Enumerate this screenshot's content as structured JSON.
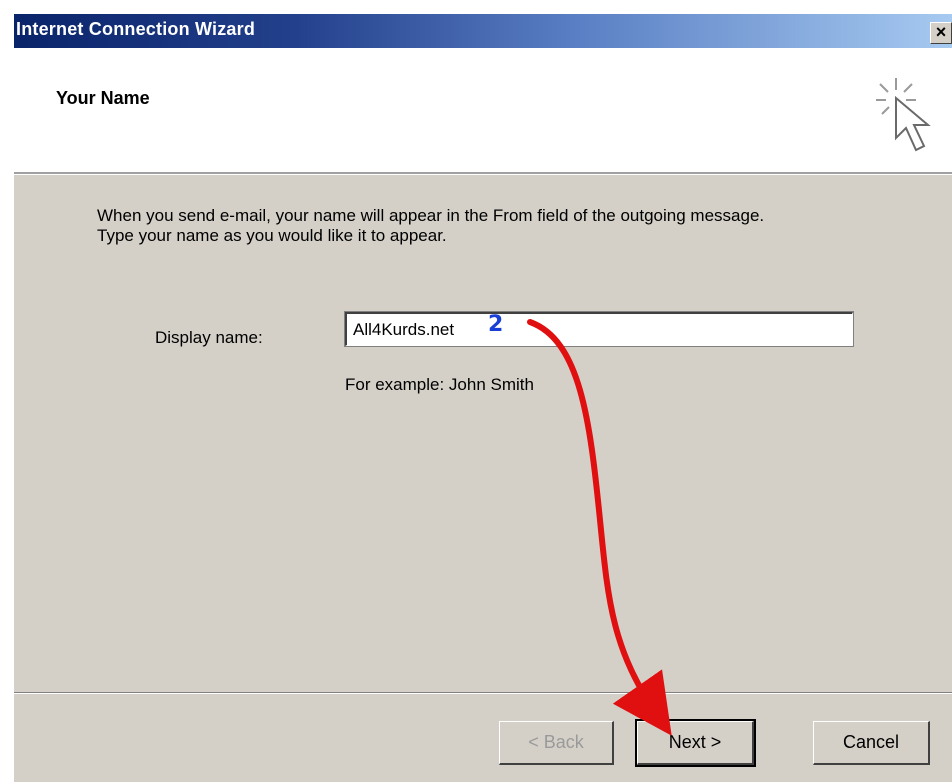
{
  "window": {
    "title": "Internet Connection Wizard",
    "close_glyph": "✕"
  },
  "header": {
    "title": "Your Name",
    "icon": "wizard-cursor-sparkle-icon"
  },
  "body": {
    "description_line1": "When you send e-mail, your name will appear in the From field of the outgoing message.",
    "description_line2": "Type your name as you would like it to appear.",
    "display_name_label": "Display name:",
    "display_name_value": "All4Kurds.net",
    "example_text": "For example: John Smith"
  },
  "annotation": {
    "step_number": "2",
    "arrow_color": "#e01010",
    "number_color": "#1a3fd6"
  },
  "buttons": {
    "back": "< Back",
    "next": "Next >",
    "cancel": "Cancel"
  },
  "colors": {
    "titlebar_start": "#0a246a",
    "titlebar_end": "#a6caf0",
    "dialog_bg": "#d4d0c8"
  }
}
